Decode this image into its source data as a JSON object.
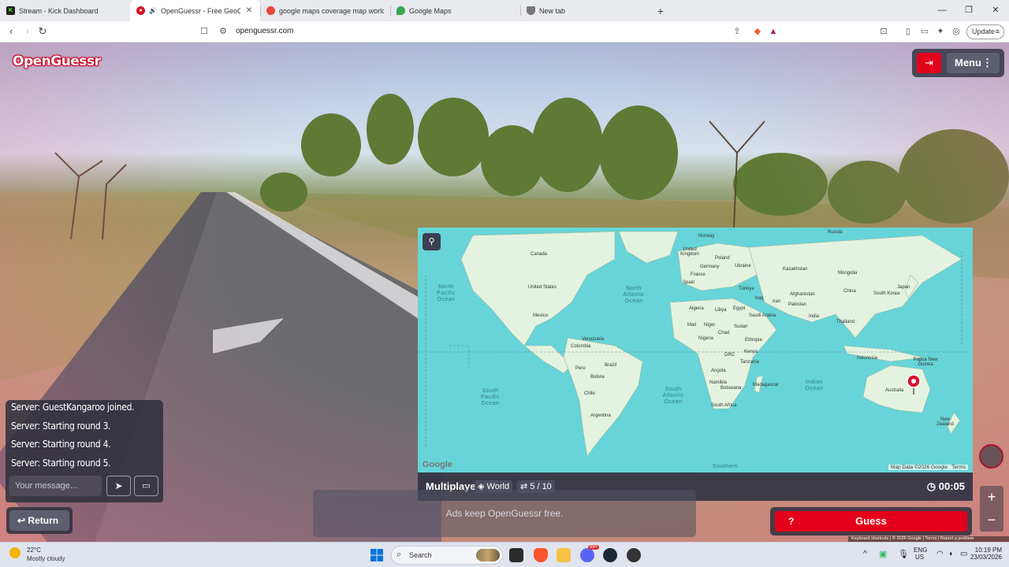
{
  "browser": {
    "tabs": [
      {
        "title": "Stream - Kick Dashboard",
        "favicon": "kick-icon",
        "color": "#1f1f1f",
        "active": false
      },
      {
        "title": "OpenGuessr - Free GeoGuess",
        "favicon": "openguessr-icon",
        "color": "#d3122a",
        "active": true,
        "audio": true
      },
      {
        "title": "google maps coverage map world -",
        "favicon": "search-icon",
        "color": "#e8453c",
        "active": false
      },
      {
        "title": "Google Maps",
        "favicon": "maps-icon",
        "color": "#34a853",
        "active": false
      },
      {
        "title": "New tab",
        "favicon": "brave-shield-icon",
        "color": "#666666",
        "active": false
      }
    ],
    "url": "openguessr.com",
    "update_label": "Update"
  },
  "game": {
    "logo": "OpenGuessr",
    "menu_label": "Menu",
    "chat": {
      "lines": [
        "Server: GuestKangaroo joined.",
        "Server: Starting round 3.",
        "Server: Starting round 4.",
        "Server: Starting round 5."
      ],
      "placeholder": "Your message..."
    },
    "return_label": "Return",
    "ads_text": "Ads keep OpenGuessr free.",
    "guess_label": "Guess",
    "guess_help": "?",
    "mapbar": {
      "mode": "Multiplayer",
      "region": "World",
      "round": "5 / 10",
      "timer": "00:05"
    },
    "map": {
      "google_logo": "Google",
      "attribution": "Map Data ©2026 Google",
      "terms": "Terms",
      "countries": [
        "Canada",
        "United States",
        "Mexico",
        "Venezuela",
        "Colombia",
        "Peru",
        "Brazil",
        "Bolivia",
        "Chile",
        "Argentina",
        "Norway",
        "Russia",
        "United Kingdom",
        "Poland",
        "Germany",
        "France",
        "Spain",
        "Ukraine",
        "Kazakhstan",
        "Mongolia",
        "China",
        "South Korea",
        "Japan",
        "Türkiye",
        "Iraq",
        "Iran",
        "Afghanistan",
        "Pakistan",
        "India",
        "Thailand",
        "Indonesia",
        "Papua New Guinea",
        "Australia",
        "New Zealand",
        "Algeria",
        "Libya",
        "Egypt",
        "Mali",
        "Niger",
        "Sudan",
        "Chad",
        "Saudi Arabia",
        "Nigeria",
        "Ethiopia",
        "Kenya",
        "DRC",
        "Tanzania",
        "Angola",
        "Namibia",
        "Botswana",
        "Madagascar",
        "South Africa"
      ],
      "oceans": [
        "North Pacific Ocean",
        "North Atlantic Ocean",
        "South Pacific Ocean",
        "South Atlantic Ocean",
        "Indian Ocean",
        "Southern"
      ]
    },
    "footer": {
      "keyboard": "Keyboard shortcuts",
      "copyright": "© 2026 Google",
      "terms": "Terms",
      "report": "Report a problem"
    }
  },
  "taskbar": {
    "temperature": "22°C",
    "weather": "Mostly cloudy",
    "search_label": "Search",
    "lang": "ENG",
    "region": "US",
    "time": "10:19 PM",
    "date": "23/03/2026",
    "discord_badge": "99+"
  }
}
